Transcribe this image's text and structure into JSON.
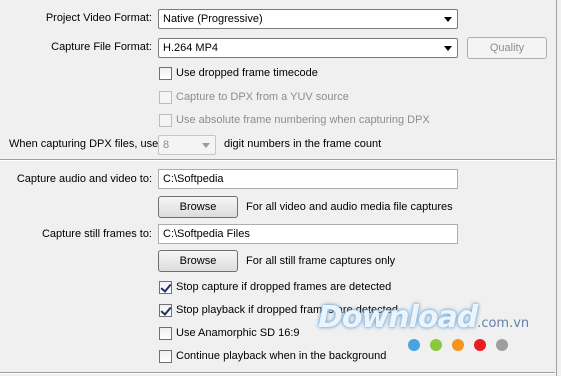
{
  "project_video_format": {
    "label": "Project Video Format:",
    "value": "Native (Progressive)"
  },
  "capture_file_format": {
    "label": "Capture File Format:",
    "value": "H.264 MP4",
    "quality_button": "Quality"
  },
  "checkboxes_top": [
    {
      "label": "Use dropped frame timecode",
      "checked": false,
      "enabled": true
    },
    {
      "label": "Capture to DPX from a YUV source",
      "checked": false,
      "enabled": false
    },
    {
      "label": "Use absolute frame numbering when capturing DPX",
      "checked": false,
      "enabled": false
    }
  ],
  "dpx_digits": {
    "label_before": "When capturing DPX files, use",
    "value": "8",
    "label_after": "digit numbers in the frame count"
  },
  "capture_audio_video": {
    "label": "Capture audio and video to:",
    "path": "C:\\Softpedia",
    "browse": "Browse",
    "note": "For all video and audio media file captures"
  },
  "capture_still_frames": {
    "label": "Capture still frames to:",
    "path": "C:\\Softpedia Files",
    "browse": "Browse",
    "note": "For all still frame captures only"
  },
  "checkboxes_bottom": [
    {
      "label": "Stop capture if dropped frames are detected",
      "checked": true
    },
    {
      "label": "Stop playback if dropped frames are detected",
      "checked": true
    },
    {
      "label": "Use Anamorphic SD 16:9",
      "checked": false
    },
    {
      "label": "Continue playback when in the background",
      "checked": false
    }
  ],
  "watermark": {
    "text": "Download",
    "suffix": ".com.vn"
  },
  "colors": {
    "divider": "#a0a0a0",
    "disabled_text": "#8d8d8d",
    "watermark_dots": [
      "#4aa3df",
      "#8dc63f",
      "#f7941d",
      "#ec1c24",
      "#9e9e9e"
    ]
  }
}
